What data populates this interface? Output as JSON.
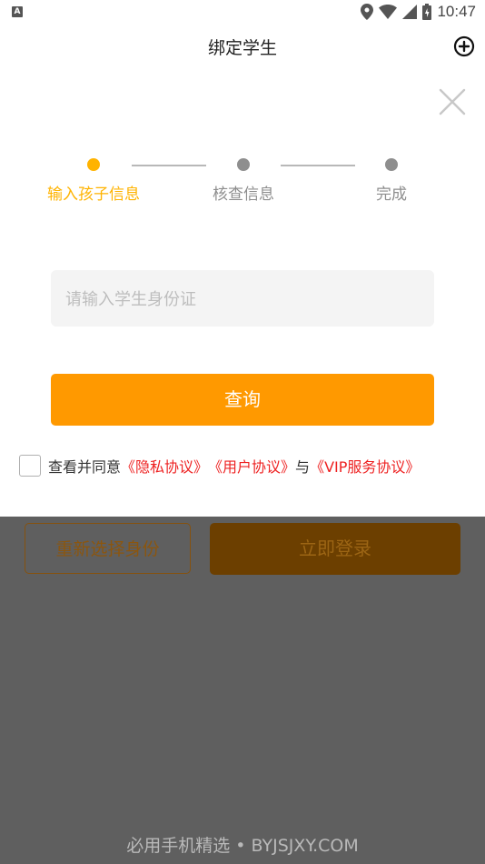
{
  "status_bar": {
    "app_icon_letter": "A",
    "time": "10:47",
    "icons": [
      "location-icon",
      "wifi-icon",
      "signal-icon",
      "battery-icon"
    ]
  },
  "header": {
    "title": "绑定学生",
    "add_icon": "add-circle-icon"
  },
  "close_icon": "close-icon",
  "steps": {
    "items": [
      {
        "label": "输入孩子信息",
        "active": true
      },
      {
        "label": "核查信息",
        "active": false
      },
      {
        "label": "完成",
        "active": false
      }
    ],
    "active_color": "#ffb300",
    "inactive_color": "#8e8e8e"
  },
  "id_input": {
    "value": "",
    "placeholder": "请输入学生身份证"
  },
  "query_button": {
    "label": "查询",
    "color": "#ff9900"
  },
  "agreement": {
    "checked": false,
    "prefix": "查看并同意",
    "privacy": "《隐私协议》",
    "user": "《用户协议》",
    "and": "与",
    "vip": "《VIP服务协议》",
    "link_color": "#ee2222"
  },
  "background_buttons": {
    "reselect_label": "重新选择身份",
    "login_label": "立即登录"
  },
  "watermark": "必用手机精选 • BYJSJXY.COM"
}
